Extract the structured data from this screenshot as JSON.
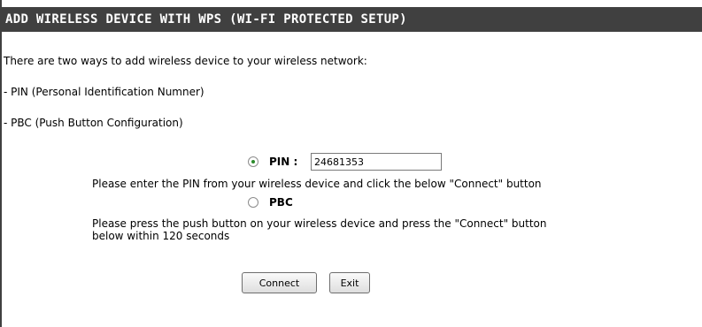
{
  "header": {
    "title": "ADD WIRELESS DEVICE WITH WPS (WI-FI PROTECTED SETUP)"
  },
  "intro": {
    "text": "There are two ways to add wireless device to your wireless network:",
    "pin_method": "- PIN (Personal Identification Numner)",
    "pbc_method": "- PBC (Push Button Configuration)"
  },
  "options": {
    "pin": {
      "label": "PIN :",
      "value": "24681353",
      "selected": true,
      "description": "Please enter the PIN from your wireless device and click the below \"Connect\" button"
    },
    "pbc": {
      "label": "PBC",
      "selected": false,
      "description_line1": "Please press the push button on your wireless device and press the \"Connect\" button",
      "description_line2": "below within 120 seconds"
    }
  },
  "buttons": {
    "connect": "Connect",
    "exit": "Exit"
  },
  "colors": {
    "header_background": "#404040",
    "header_text": "#ffffff",
    "radio_dot": "#2a8a2a"
  }
}
